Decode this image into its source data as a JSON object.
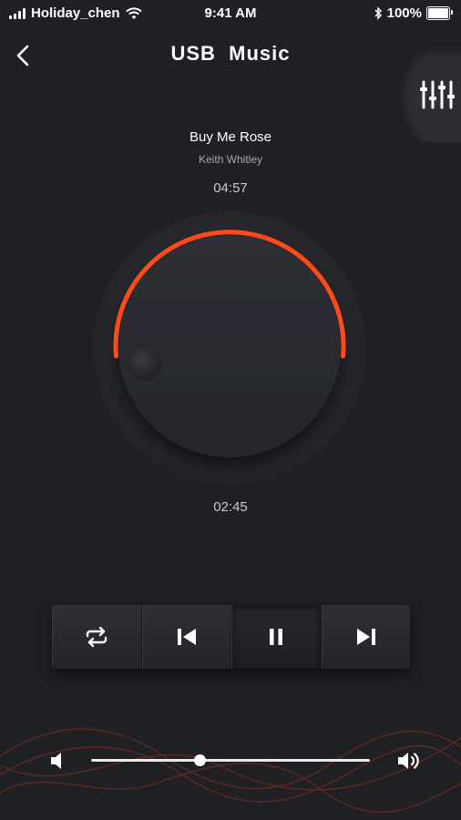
{
  "status_bar": {
    "carrier": "Holiday_chen",
    "time": "9:41 AM",
    "battery": "100%"
  },
  "header": {
    "title": "USB  Music",
    "back_icon": "chevron-left-icon",
    "equalizer_icon": "sliders-icon"
  },
  "track": {
    "title": "Buy Me Rose",
    "artist": "Keith Whitley",
    "total_time": "04:57",
    "current_time": "02:45"
  },
  "knob": {
    "progress_fraction": 0.5,
    "accent_color": "#ff4a1a"
  },
  "controls": [
    {
      "name": "repeat-button",
      "icon": "repeat-icon"
    },
    {
      "name": "previous-button",
      "icon": "skip-back-icon"
    },
    {
      "name": "pause-button",
      "icon": "pause-icon"
    },
    {
      "name": "next-button",
      "icon": "skip-forward-icon"
    }
  ],
  "volume": {
    "level_fraction": 0.39,
    "low_icon": "volume-low-icon",
    "high_icon": "volume-high-icon"
  },
  "colors": {
    "background": "#1f2023",
    "accent": "#ff4a1a"
  }
}
